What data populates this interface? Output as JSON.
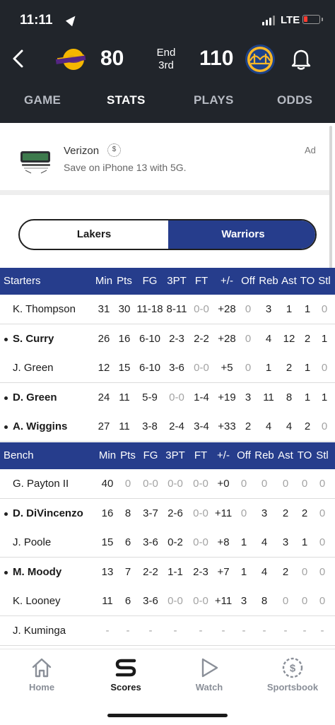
{
  "status_bar": {
    "time": "11:11",
    "network": "LTE"
  },
  "game": {
    "away_score": "80",
    "home_score": "110",
    "status_line1": "End",
    "status_line2": "3rd"
  },
  "tabs": [
    {
      "label": "GAME"
    },
    {
      "label": "STATS"
    },
    {
      "label": "PLAYS"
    },
    {
      "label": "ODDS"
    }
  ],
  "ad": {
    "sponsor": "Verizon",
    "text": "Save on iPhone 13 with 5G.",
    "tag": "Ad",
    "coin": "$"
  },
  "team_toggle": {
    "left": "Lakers",
    "right": "Warriors"
  },
  "columns": [
    "Min",
    "Pts",
    "FG",
    "3PT",
    "FT",
    "+/-",
    "Off",
    "Reb",
    "Ast",
    "TO",
    "Stl"
  ],
  "starters": {
    "title": "Starters",
    "rows": [
      {
        "name": "K. Thompson",
        "bold": false,
        "stats": [
          "31",
          "30",
          "11-18",
          "8-11",
          "0-0",
          "+28",
          "0",
          "3",
          "1",
          "1",
          "0"
        ]
      },
      {
        "name": "S. Curry",
        "bold": true,
        "stats": [
          "26",
          "16",
          "6-10",
          "2-3",
          "2-2",
          "+28",
          "0",
          "4",
          "12",
          "2",
          "1"
        ]
      },
      {
        "name": "J. Green",
        "bold": false,
        "stats": [
          "12",
          "15",
          "6-10",
          "3-6",
          "0-0",
          "+5",
          "0",
          "1",
          "2",
          "1",
          "0"
        ]
      },
      {
        "name": "D. Green",
        "bold": true,
        "stats": [
          "24",
          "11",
          "5-9",
          "0-0",
          "1-4",
          "+19",
          "3",
          "11",
          "8",
          "1",
          "1"
        ]
      },
      {
        "name": "A. Wiggins",
        "bold": true,
        "stats": [
          "27",
          "11",
          "3-8",
          "2-4",
          "3-4",
          "+33",
          "2",
          "4",
          "4",
          "2",
          "0"
        ]
      }
    ]
  },
  "bench": {
    "title": "Bench",
    "rows": [
      {
        "name": "G. Payton II",
        "bold": false,
        "stats": [
          "40",
          "0",
          "0-0",
          "0-0",
          "0-0",
          "+0",
          "0",
          "0",
          "0",
          "0",
          "0"
        ]
      },
      {
        "name": "D. DiVincenzo",
        "bold": true,
        "stats": [
          "16",
          "8",
          "3-7",
          "2-6",
          "0-0",
          "+11",
          "0",
          "3",
          "2",
          "2",
          "0"
        ]
      },
      {
        "name": "J. Poole",
        "bold": false,
        "stats": [
          "15",
          "6",
          "3-6",
          "0-2",
          "0-0",
          "+8",
          "1",
          "4",
          "3",
          "1",
          "0"
        ]
      },
      {
        "name": "M. Moody",
        "bold": true,
        "stats": [
          "13",
          "7",
          "2-2",
          "1-1",
          "2-3",
          "+7",
          "1",
          "4",
          "2",
          "0",
          "0"
        ]
      },
      {
        "name": "K. Looney",
        "bold": false,
        "stats": [
          "11",
          "6",
          "3-6",
          "0-0",
          "0-0",
          "+11",
          "3",
          "8",
          "0",
          "0",
          "0"
        ]
      },
      {
        "name": "J. Kuminga",
        "bold": false,
        "stats": [
          "-",
          "-",
          "-",
          "-",
          "-",
          "-",
          "-",
          "-",
          "-",
          "-",
          "-"
        ]
      }
    ]
  },
  "bottom_nav": [
    {
      "label": "Home",
      "icon": "home-icon"
    },
    {
      "label": "Scores",
      "icon": "scores-icon"
    },
    {
      "label": "Watch",
      "icon": "play-icon"
    },
    {
      "label": "Sportsbook",
      "icon": "sportsbook-icon"
    }
  ],
  "colors": {
    "header_bg": "#21252b",
    "accent": "#263d8c",
    "dim_text": "#a3a3a3"
  }
}
